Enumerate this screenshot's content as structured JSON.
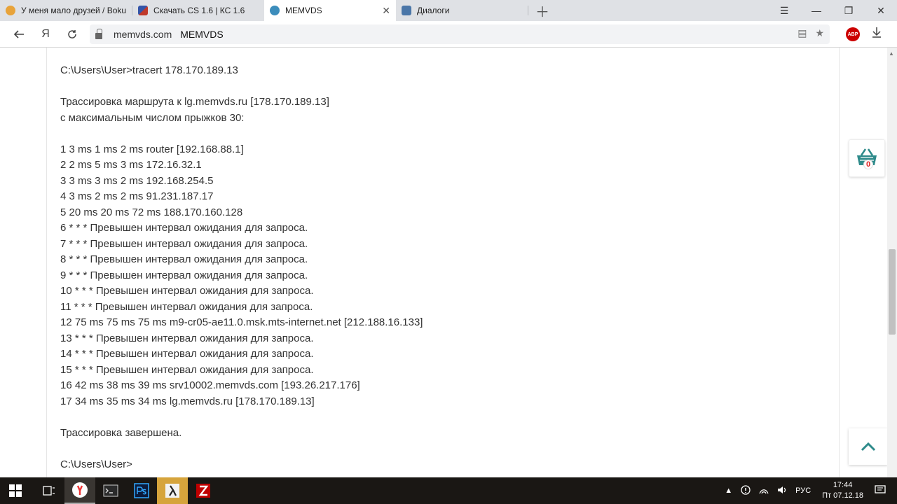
{
  "browser": {
    "tabs": [
      {
        "label": "У меня мало друзей / Boku",
        "icon": "face-icon",
        "color": "#e8a33a",
        "active": false
      },
      {
        "label": "Скачать CS 1.6 | КС 1.6",
        "icon": "cs-icon",
        "color": "#3455a8",
        "active": false
      },
      {
        "label": "MEMVDS",
        "icon": "hexagon-icon",
        "color": "#3c8dbc",
        "active": true
      },
      {
        "label": "Диалоги",
        "icon": "chat-icon",
        "color": "#4a76a8",
        "active": false
      }
    ],
    "address": {
      "domain": "memvds.com",
      "title": "MEMVDS"
    },
    "abp_label": "ABP"
  },
  "terminal": {
    "lines": [
      "C:\\Users\\User>tracert 178.170.189.13",
      "",
      "Трассировка маршрута к lg.memvds.ru [178.170.189.13]",
      "с максимальным числом прыжков 30:",
      "",
      "1 3 ms 1 ms 2 ms router [192.168.88.1]",
      "2 2 ms 5 ms 3 ms 172.16.32.1",
      "3 3 ms 3 ms 2 ms 192.168.254.5",
      "4 3 ms 2 ms 2 ms 91.231.187.17",
      "5 20 ms 20 ms 72 ms 188.170.160.128",
      "6 * * * Превышен интервал ожидания для запроса.",
      "7 * * * Превышен интервал ожидания для запроса.",
      "8 * * * Превышен интервал ожидания для запроса.",
      "9 * * * Превышен интервал ожидания для запроса.",
      "10 * * * Превышен интервал ожидания для запроса.",
      "11 * * * Превышен интервал ожидания для запроса.",
      "12 75 ms 75 ms 75 ms m9-cr05-ae11.0.msk.mts-internet.net [212.188.16.133]",
      "13 * * * Превышен интервал ожидания для запроса.",
      "14 * * * Превышен интервал ожидания для запроса.",
      "15 * * * Превышен интервал ожидания для запроса.",
      "16 42 ms 38 ms 39 ms srv10002.memvds.com [193.26.217.176]",
      "17 34 ms 35 ms 34 ms lg.memvds.ru [178.170.189.13]",
      "",
      "Трассировка завершена.",
      "",
      "C:\\Users\\User>"
    ]
  },
  "widgets": {
    "cart_count": "0",
    "accent": "#2e8b8b"
  },
  "taskbar": {
    "apps": [
      "yandex-browser-icon",
      "terminal-icon",
      "photoshop-icon",
      "cs-game-icon",
      "filezilla-icon"
    ],
    "tray": {
      "language": "РУС",
      "time": "17:44",
      "date": "Пт 07.12.18"
    }
  }
}
